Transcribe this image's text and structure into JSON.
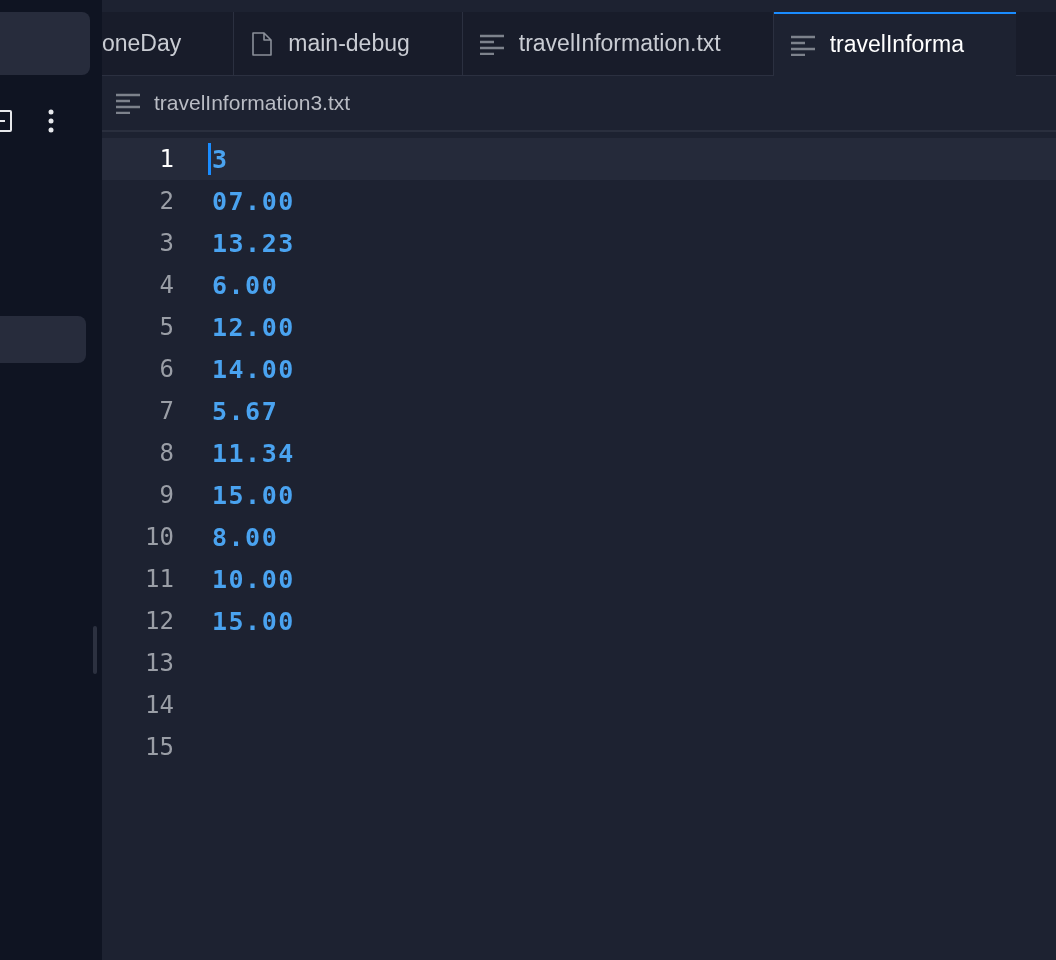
{
  "tabs": [
    {
      "label": "oneDay",
      "kind": "plain",
      "selected": false
    },
    {
      "label": "main-debug",
      "kind": "file",
      "selected": false
    },
    {
      "label": "travelInformation.txt",
      "kind": "text",
      "selected": false
    },
    {
      "label": "travelInforma",
      "kind": "text",
      "selected": true
    }
  ],
  "breadcrumb": {
    "kind": "text",
    "label": "travelInformation3.txt"
  },
  "lines": [
    {
      "number": "1",
      "text": "3",
      "current": true
    },
    {
      "number": "2",
      "text": "07.00",
      "current": false
    },
    {
      "number": "3",
      "text": "13.23",
      "current": false
    },
    {
      "number": "4",
      "text": "6.00",
      "current": false
    },
    {
      "number": "5",
      "text": "12.00",
      "current": false
    },
    {
      "number": "6",
      "text": "14.00",
      "current": false
    },
    {
      "number": "7",
      "text": "5.67",
      "current": false
    },
    {
      "number": "8",
      "text": "11.34",
      "current": false
    },
    {
      "number": "9",
      "text": "15.00",
      "current": false
    },
    {
      "number": "10",
      "text": "8.00",
      "current": false
    },
    {
      "number": "11",
      "text": "10.00",
      "current": false
    },
    {
      "number": "12",
      "text": "15.00",
      "current": false
    },
    {
      "number": "13",
      "current": false
    },
    {
      "number": "14",
      "current": false
    },
    {
      "number": "15",
      "current": false
    }
  ]
}
